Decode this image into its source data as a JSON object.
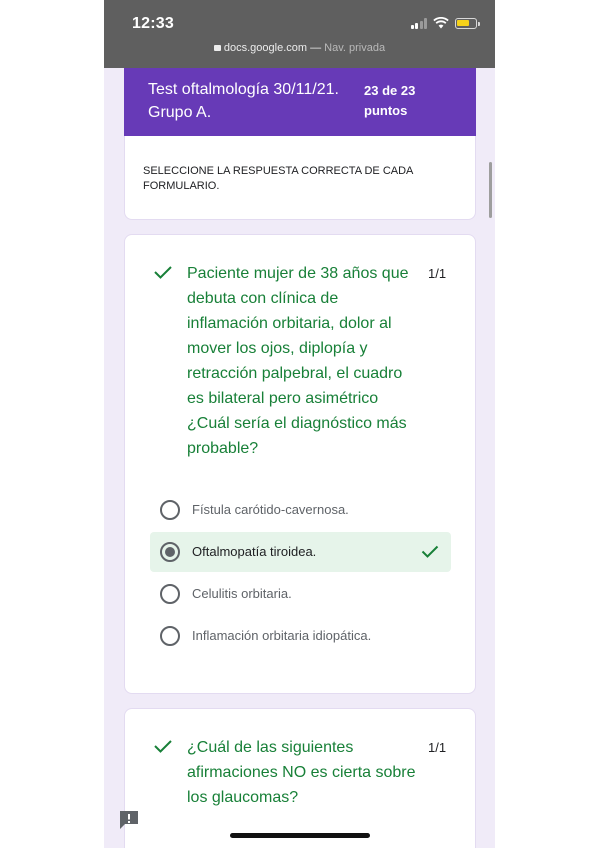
{
  "status_bar": {
    "time": "12:33",
    "url": "docs.google.com",
    "separator": " — ",
    "browsing_mode": "Nav. privada"
  },
  "form": {
    "title": "Test oftalmología 30/11/21. Grupo A.",
    "score": "23 de 23 puntos",
    "description": "SELECCIONE LA RESPUESTA CORRECTA DE CADA FORMULARIO.",
    "accent_color": "#673ab7",
    "correct_color": "#188038"
  },
  "questions": [
    {
      "text": "Paciente mujer de 38 años que debuta con clínica de inflamación orbitaria, dolor al mover los ojos, diplopía y retracción palpebral, el cuadro es bilateral pero asimétrico ¿Cuál sería el diagnóstico más probable?",
      "points": "1/1",
      "options": [
        {
          "label": "Fístula carótido-cavernosa.",
          "selected": false,
          "correct": false
        },
        {
          "label": "Oftalmopatía tiroidea.",
          "selected": true,
          "correct": true
        },
        {
          "label": "Celulitis orbitaria.",
          "selected": false,
          "correct": false
        },
        {
          "label": "Inflamación orbitaria idiopática.",
          "selected": false,
          "correct": false
        }
      ]
    },
    {
      "text": "¿Cuál de las siguientes afirmaciones NO es cierta sobre los glaucomas?",
      "points": "1/1"
    }
  ],
  "icons": {
    "status_check": "check-icon",
    "feedback": "report-issue-icon"
  }
}
